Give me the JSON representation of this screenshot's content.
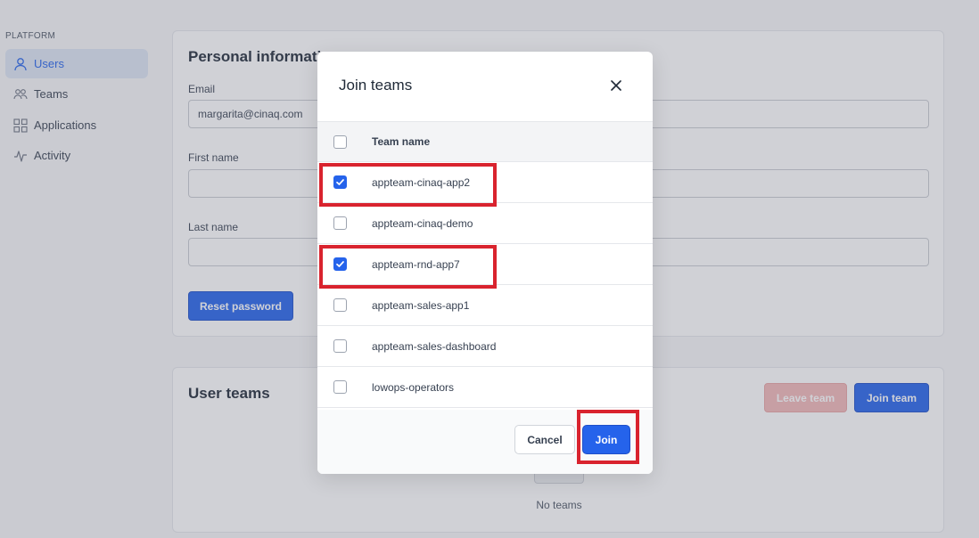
{
  "sidebar": {
    "section_title": "PLATFORM",
    "items": [
      {
        "label": "Users",
        "icon": "user-icon",
        "active": true
      },
      {
        "label": "Teams",
        "icon": "teams-icon",
        "active": false
      },
      {
        "label": "Applications",
        "icon": "applications-icon",
        "active": false
      },
      {
        "label": "Activity",
        "icon": "activity-icon",
        "active": false
      }
    ]
  },
  "personal": {
    "title": "Personal information",
    "email_label": "Email",
    "email_value": "margarita@cinaq.com",
    "first_name_label": "First name",
    "first_name_value": "",
    "last_name_label": "Last name",
    "last_name_value": "",
    "reset_password_label": "Reset password"
  },
  "user_teams": {
    "title": "User teams",
    "leave_team_label": "Leave team",
    "join_team_label": "Join team",
    "empty_text": "No teams"
  },
  "modal": {
    "title": "Join teams",
    "column_header": "Team name",
    "rows": [
      {
        "name": "appteam-cinaq-app2",
        "checked": true
      },
      {
        "name": "appteam-cinaq-demo",
        "checked": false
      },
      {
        "name": "appteam-rnd-app7",
        "checked": true
      },
      {
        "name": "appteam-sales-app1",
        "checked": false
      },
      {
        "name": "appteam-sales-dashboard",
        "checked": false
      },
      {
        "name": "lowops-operators",
        "checked": false
      }
    ],
    "cancel_label": "Cancel",
    "join_label": "Join"
  },
  "colors": {
    "accent": "#2563eb",
    "highlight": "#d9232e",
    "danger_disabled": "#f2b8b8"
  }
}
